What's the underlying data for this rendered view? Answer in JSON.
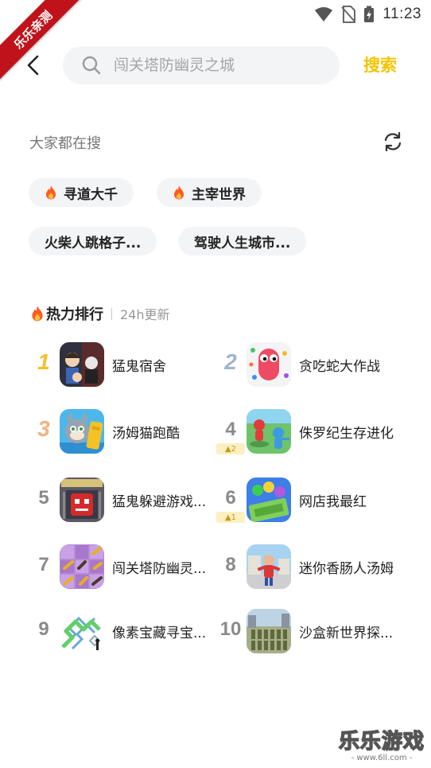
{
  "status_bar": {
    "time": "11:23"
  },
  "watermark": {
    "ribbon": "乐乐亲测",
    "bottom_title": "乐乐游戏",
    "bottom_url": "- www.6ll.com -"
  },
  "search": {
    "placeholder": "闯关塔防幽灵之城",
    "button": "搜索"
  },
  "trending": {
    "title": "大家都在搜",
    "tags": [
      {
        "label": "寻道大千",
        "hot": true
      },
      {
        "label": "主宰世界",
        "hot": true
      },
      {
        "label": "火柴人跳格子...",
        "hot": false
      },
      {
        "label": "驾驶人生城市...",
        "hot": false
      }
    ]
  },
  "ranking": {
    "title": "热力排行",
    "subtitle": "24h更新",
    "items": [
      {
        "rank": "1",
        "name": "猛鬼宿舍"
      },
      {
        "rank": "2",
        "name": "贪吃蛇大作战"
      },
      {
        "rank": "3",
        "name": "汤姆猫跑酷"
      },
      {
        "rank": "4",
        "name": "侏罗纪生存进化",
        "trend": "2"
      },
      {
        "rank": "5",
        "name": "猛鬼躲避游戏..."
      },
      {
        "rank": "6",
        "name": "网店我最红",
        "trend": "1"
      },
      {
        "rank": "7",
        "name": "闯关塔防幽灵..."
      },
      {
        "rank": "8",
        "name": "迷你香肠人汤姆"
      },
      {
        "rank": "9",
        "name": "像素宝藏寻宝..."
      },
      {
        "rank": "10",
        "name": "沙盒新世界探..."
      }
    ]
  },
  "colors": {
    "accent": "#f5c400",
    "flame": "#ff5a1f",
    "rank1": "#f6c02c",
    "rank2": "#9fb4cf",
    "rank3": "#f2b27d"
  }
}
